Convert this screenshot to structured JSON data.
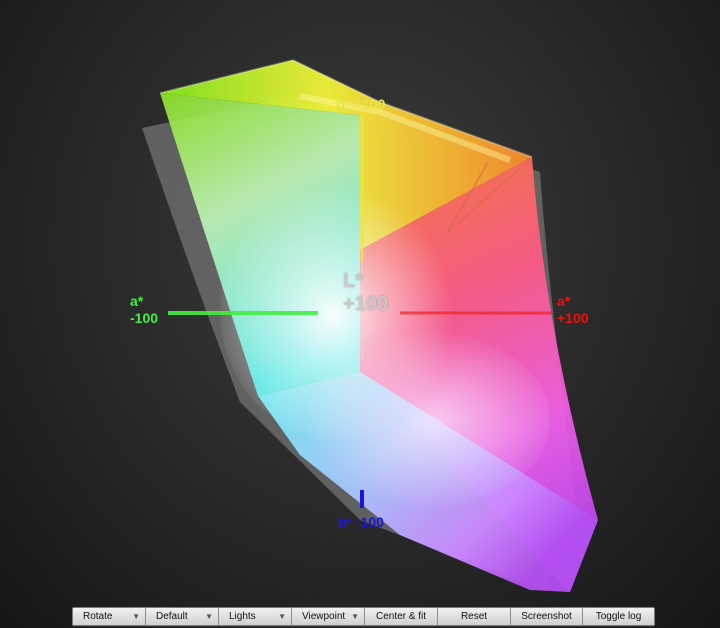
{
  "axes": {
    "b_plus": "b* +100",
    "b_minus": "b* -100",
    "a_minus_name": "a*",
    "a_minus_value": "-100",
    "a_plus_name": "a*",
    "a_plus_value": "+100",
    "l_name": "L*",
    "l_value": "+100"
  },
  "colors": {
    "a_minus": "#44ee44",
    "a_plus": "#ee1111",
    "b_plus": "#e8e84a",
    "b_minus": "#1616dd",
    "l_axis": "#cfcfcf"
  },
  "toolbar": {
    "buttons": [
      {
        "label": "Rotate",
        "dropdown": true
      },
      {
        "label": "Default",
        "dropdown": true
      },
      {
        "label": "Lights",
        "dropdown": true
      },
      {
        "label": "Viewpoint",
        "dropdown": true
      },
      {
        "label": "Center & fit",
        "dropdown": false
      },
      {
        "label": "Reset",
        "dropdown": false
      },
      {
        "label": "Screenshot",
        "dropdown": false
      },
      {
        "label": "Toggle log",
        "dropdown": false
      }
    ],
    "dropdown_arrow": "▼"
  }
}
